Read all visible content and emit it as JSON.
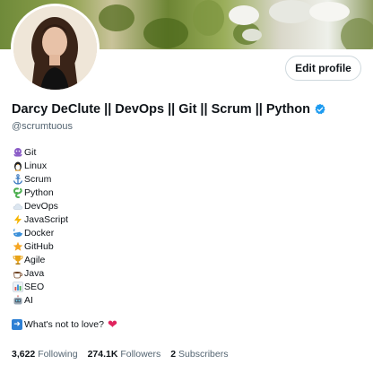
{
  "profile": {
    "name": "Darcy DeClute || DevOps || Git || Scrum || Python",
    "handle": "@scrumtuous",
    "edit_label": "Edit profile",
    "verified_color": "#1d9bf0"
  },
  "bio": {
    "items": [
      {
        "icon": "octopus-icon",
        "label": "Git"
      },
      {
        "icon": "penguin-icon",
        "label": "Linux"
      },
      {
        "icon": "anchor-icon",
        "label": "Scrum"
      },
      {
        "icon": "snake-icon",
        "label": "Python"
      },
      {
        "icon": "cloud-icon",
        "label": "DevOps"
      },
      {
        "icon": "lightning-icon",
        "label": "JavaScript"
      },
      {
        "icon": "whale-icon",
        "label": "Docker"
      },
      {
        "icon": "star-icon",
        "label": "GitHub"
      },
      {
        "icon": "trophy-icon",
        "label": "Agile"
      },
      {
        "icon": "coffee-icon",
        "label": "Java"
      },
      {
        "icon": "bar-chart-icon",
        "label": "SEO"
      },
      {
        "icon": "robot-icon",
        "label": "AI"
      }
    ],
    "tagline": "What's not to love?"
  },
  "stats": {
    "following_count": "3,622",
    "following_label": "Following",
    "followers_count": "274.1K",
    "followers_label": "Followers",
    "subscribers_count": "2",
    "subscribers_label": "Subscribers"
  }
}
